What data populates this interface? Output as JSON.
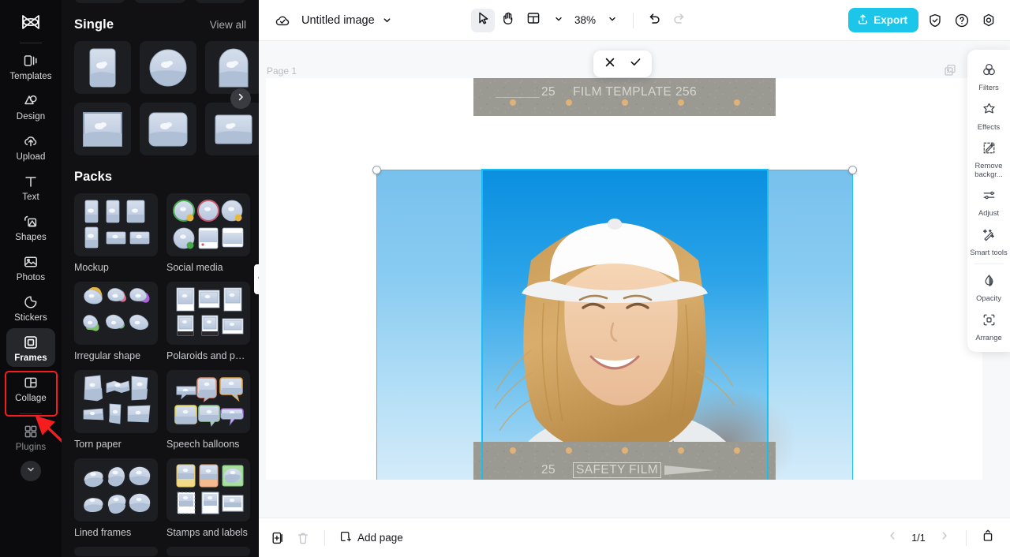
{
  "rail": {
    "logo_icon": "capcut-logo-icon",
    "items": [
      {
        "label": "Templates",
        "icon": "templates-icon",
        "active": false
      },
      {
        "label": "Design",
        "icon": "design-icon",
        "active": false
      },
      {
        "label": "Upload",
        "icon": "upload-cloud-icon",
        "active": false
      },
      {
        "label": "Text",
        "icon": "text-icon",
        "active": false
      },
      {
        "label": "Shapes",
        "icon": "shapes-icon",
        "active": false
      },
      {
        "label": "Photos",
        "icon": "photos-icon",
        "active": false
      },
      {
        "label": "Stickers",
        "icon": "stickers-icon",
        "active": false
      },
      {
        "label": "Frames",
        "icon": "frames-icon",
        "active": true
      },
      {
        "label": "Collage",
        "icon": "collage-icon",
        "active": false
      },
      {
        "label": "Plugins",
        "icon": "plugins-icon",
        "active": false
      }
    ],
    "expand_icon": "chevron-down-icon"
  },
  "panel": {
    "single": {
      "title": "Single",
      "view_all": "View all",
      "next_icon": "chevron-right-icon",
      "thumbs": [
        "rounded-rect-portrait",
        "circle",
        "arch",
        "square-outline",
        "rounded-square",
        "inset-rect"
      ]
    },
    "packs": {
      "title": "Packs",
      "items": [
        {
          "label": "Mockup"
        },
        {
          "label": "Social media"
        },
        {
          "label": "Irregular shape"
        },
        {
          "label": "Polaroids and photo ..."
        },
        {
          "label": "Torn paper"
        },
        {
          "label": "Speech balloons"
        },
        {
          "label": "Lined frames"
        },
        {
          "label": "Stamps and labels"
        }
      ]
    },
    "collapse_icon": "chevron-left-icon"
  },
  "topbar": {
    "cloud_icon": "cloud-saved-icon",
    "doc_title": "Untitled image",
    "title_caret_icon": "chevron-down-icon",
    "tools": [
      {
        "name": "select-tool",
        "icon": "cursor-arrow-icon",
        "selected": true
      },
      {
        "name": "hand-tool",
        "icon": "hand-icon",
        "selected": false
      },
      {
        "name": "layout-tool",
        "icon": "layout-icon",
        "selected": false
      }
    ],
    "layout_caret_icon": "chevron-down-icon",
    "zoom_level": "38%",
    "zoom_caret_icon": "chevron-down-icon",
    "undo_icon": "undo-icon",
    "redo_icon": "redo-icon",
    "export_label": "Export",
    "export_icon": "export-upload-icon",
    "export_color": "#1cc6ea",
    "shield_icon": "shield-check-icon",
    "help_icon": "question-circle-icon",
    "settings_icon": "settings-gear-icon"
  },
  "canvas": {
    "page_label": "Page 1",
    "duplicate_icon": "duplicate-page-icon",
    "confirm": {
      "cancel_icon": "close-x-icon",
      "apply_icon": "check-icon"
    },
    "selection": {
      "border_color": "#17c0ee",
      "handles": [
        "top-left",
        "top-right",
        "bottom-left",
        "bottom-right"
      ]
    },
    "film": {
      "top_number": "25",
      "top_text": "FILM TEMPLATE 256",
      "bottom_number": "25",
      "bottom_text": "SAFETY FILM",
      "sprocket_color": "#dfb276",
      "strip_color": "#9a9992"
    }
  },
  "rightpanel": {
    "items": [
      {
        "label": "Filters",
        "icon": "filters-icon"
      },
      {
        "label": "Effects",
        "icon": "effects-star-icon"
      },
      {
        "label": "Remove backgr...",
        "icon": "remove-background-icon"
      },
      {
        "label": "Adjust",
        "icon": "adjust-sliders-icon"
      },
      {
        "label": "Smart tools",
        "icon": "smart-tools-wand-icon"
      },
      {
        "label": "Opacity",
        "icon": "opacity-droplet-icon"
      },
      {
        "label": "Arrange",
        "icon": "arrange-icon"
      }
    ]
  },
  "bottombar": {
    "duplicate_icon": "duplicate-icon",
    "delete_icon": "trash-icon",
    "add_page_label": "Add page",
    "add_page_icon": "add-page-icon",
    "prev_icon": "chevron-left-icon",
    "page_indicator": "1/1",
    "next_icon": "chevron-right-icon",
    "collapse_icon": "collapse-panel-icon"
  },
  "annotation": {
    "highlight_color": "#f51d1d",
    "target": "Frames"
  }
}
